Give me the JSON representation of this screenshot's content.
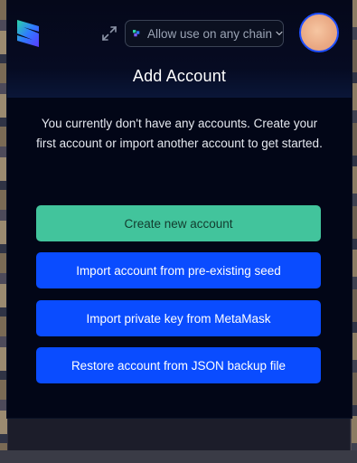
{
  "header": {
    "logo_icon": "subwallet-logo-icon",
    "expand_icon": "expand-icon",
    "chain_selector": {
      "icon": "chain-network-icon",
      "label": "Allow use on any chain",
      "chevron_icon": "chevron-down-icon"
    },
    "avatar_icon": "account-avatar"
  },
  "main": {
    "title": "Add Account",
    "description": "You currently don't have any accounts. Create your first account or import another account to get started.",
    "buttons": [
      {
        "label": "Create new account"
      },
      {
        "label": "Import account from pre-existing seed"
      },
      {
        "label": "Import private key from MetaMask"
      },
      {
        "label": "Restore account from JSON backup file"
      }
    ]
  },
  "colors": {
    "background": "#020617",
    "primary_button": "#0a4cff",
    "create_button": "#42c49c",
    "avatar_ring": "#1f4fff"
  }
}
